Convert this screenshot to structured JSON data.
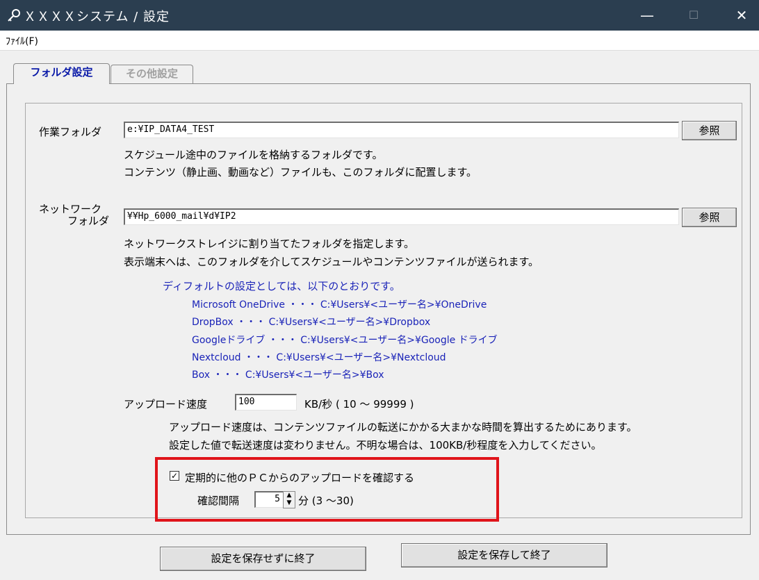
{
  "window": {
    "title": "ＸＸＸＸシステム / 設定",
    "icon": "key-icon",
    "minimize_glyph": "—",
    "maximize_glyph": "☐",
    "close_glyph": "✕"
  },
  "menu": {
    "file": "ﾌｧｲﾙ(F)"
  },
  "tabs": [
    {
      "label": "フォルダ設定",
      "active": true
    },
    {
      "label": "その他設定",
      "active": false
    }
  ],
  "work_folder": {
    "label": "作業フォルダ",
    "value": "e:¥IP_DATA4_TEST",
    "browse": "参照",
    "desc1": "スケジュール途中のファイルを格納するフォルダです。",
    "desc2": "コンテンツ（静止画、動画など）ファイルも、このフォルダに配置します。"
  },
  "network_folder": {
    "label1": "ネットワーク",
    "label2": "フォルダ",
    "value": "¥¥Hp_6000_mail¥d¥IP2",
    "browse": "参照",
    "desc1": "ネットワークストレイジに割り当てたフォルダを指定します。",
    "desc2": "表示端末へは、このフォルダを介してスケジュールやコンテンツファイルが送られます。",
    "default_heading": "ディフォルトの設定としては、以下のとおりです。",
    "defaults": [
      "Microsoft OneDrive ・・・ C:¥Users¥<ユーザー名>¥OneDrive",
      "DropBox ・・・ C:¥Users¥<ユーザー名>¥Dropbox",
      "Googleドライブ ・・・ C:¥Users¥<ユーザー名>¥Google ドライブ",
      "Nextcloud ・・・ C:¥Users¥<ユーザー名>¥Nextcloud",
      "Box ・・・ C:¥Users¥<ユーザー名>¥Box"
    ]
  },
  "upload": {
    "label": "アップロード速度",
    "value": "100",
    "unit": "KB/秒 ( 10 ～ 99999 )",
    "desc1": "アップロード速度は、コンテンツファイルの転送にかかる大まかな時間を算出するためにあります。",
    "desc2": "設定した値で転送速度は変わりません。不明な場合は、100KB/秒程度を入力してください。"
  },
  "periodic": {
    "checkbox_label": "定期的に他のＰＣからのアップロードを確認する",
    "checked": true,
    "interval_label": "確認間隔",
    "interval_value": "5",
    "interval_unit": "分 (3 ～30)",
    "highlight_color": "#e0141a"
  },
  "buttons": {
    "exit_no_save": "設定を保存せずに終了",
    "save_exit": "設定を保存して終了"
  }
}
